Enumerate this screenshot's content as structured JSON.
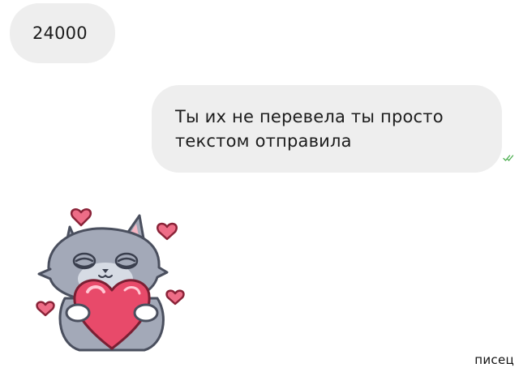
{
  "messages": {
    "incoming": {
      "text": "24000"
    },
    "outgoing": {
      "lines": [
        "Ты их не перевела ты просто",
        "текстом отправила"
      ],
      "status_icon": "double-check-icon"
    }
  },
  "sticker": {
    "icon": "cat-hugging-heart-sticker"
  },
  "watermark": {
    "text": "писец"
  },
  "colors": {
    "bubble": "#eeeeee",
    "text": "#1c1c1c",
    "read_ticks": "#4caf50",
    "cat_fur": "#a3a9b8",
    "heart": "#e84a6a",
    "small_hearts": "#d84466"
  }
}
